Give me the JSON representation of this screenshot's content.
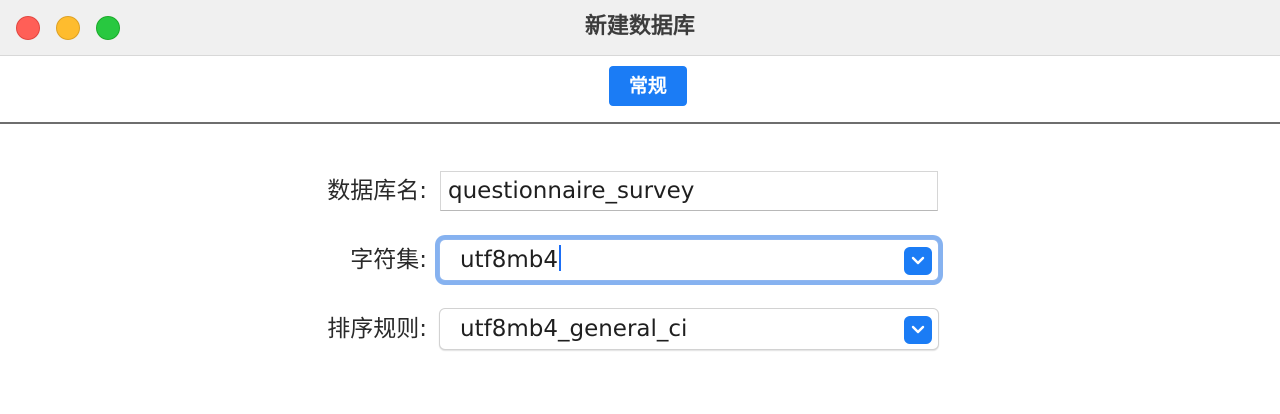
{
  "window": {
    "title": "新建数据库"
  },
  "tabs": [
    {
      "label": "常规",
      "active": true
    }
  ],
  "form": {
    "name": {
      "label": "数据库名:",
      "value": "questionnaire_survey"
    },
    "charset": {
      "label": "字符集:",
      "value": "utf8mb4"
    },
    "collation": {
      "label": "排序规则:",
      "value": "utf8mb4_general_ci"
    }
  },
  "colors": {
    "accent": "#1b7cf5",
    "traffic_close": "#ff5f57",
    "traffic_minimize": "#febc2e",
    "traffic_zoom": "#28c840"
  },
  "icons": {
    "select_arrow": "chevron-down-icon"
  }
}
